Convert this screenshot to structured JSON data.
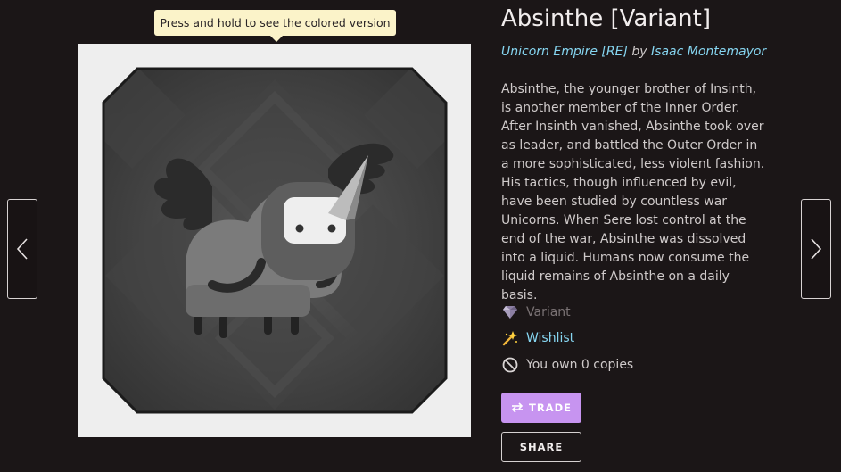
{
  "tooltip": {
    "text": "Press and hold to see the colored version"
  },
  "card": {
    "title": "Absinthe [Variant]",
    "image_icon": "unicorn-card-art"
  },
  "set": {
    "name": "Unicorn Empire [RE]",
    "by_label": "by",
    "artist": "Isaac Montemayor"
  },
  "description": "Absinthe, the younger brother of Insinth, is another member of the Inner Order. After Insinth vanished, Absinthe took over as leader, and battled the Outer Order in a more sophisticated, less violent fashion. His tactics, though influenced by evil, have been studied by countless war Unicorns. When Sere lost control at the end of the war, Absinthe was dissolved into a liquid. Humans now consume the liquid remains of Absinthe on a daily basis.",
  "meta": {
    "variant": {
      "label": "Variant",
      "icon": "gem-icon"
    },
    "wishlist": {
      "label": "Wishlist",
      "icon": "sparkle-wand-icon"
    },
    "copies": {
      "label": "You own 0 copies",
      "icon": "prohibited-icon"
    }
  },
  "buttons": {
    "trade": "TRADE",
    "share": "SHARE"
  },
  "nav": {
    "prev_icon": "chevron-left-icon",
    "next_icon": "chevron-right-icon"
  },
  "colors": {
    "background": "#1b1617",
    "accent_link": "#86d5f0",
    "trade_button": "#c794f0",
    "tooltip_bg": "#fbf3c9"
  }
}
